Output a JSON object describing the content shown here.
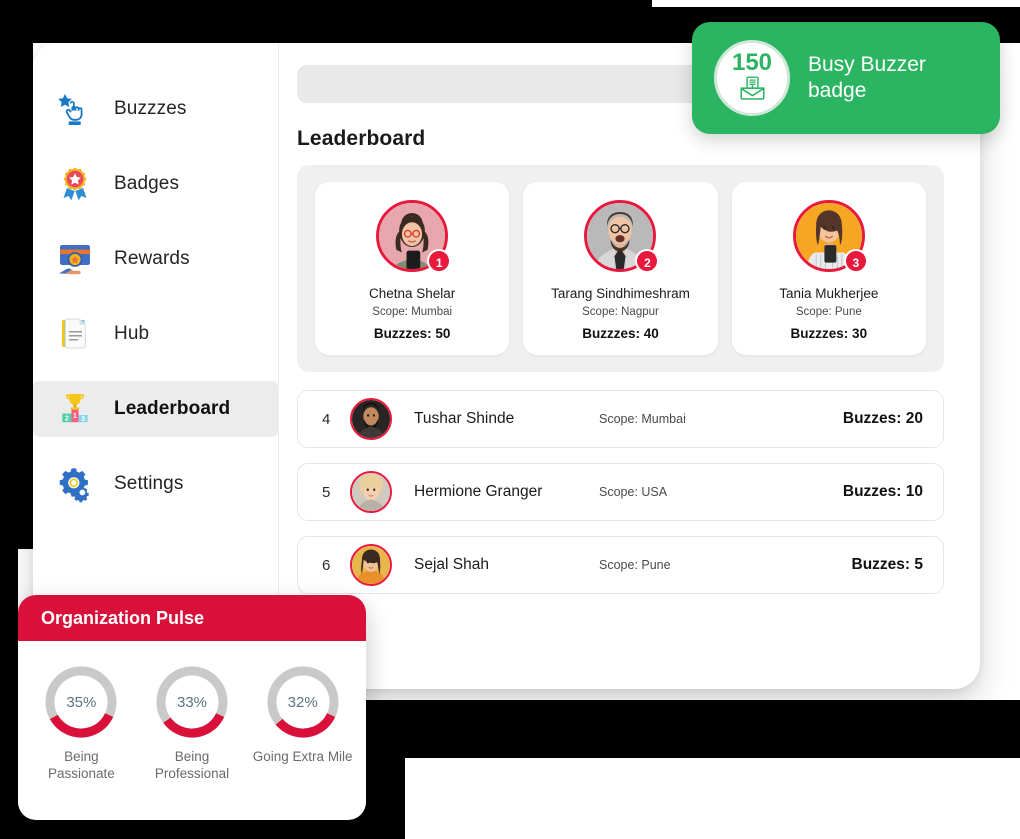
{
  "sidebar": {
    "items": [
      {
        "label": "Buzzzes",
        "icon": "hand-tap-star-icon",
        "active": false
      },
      {
        "label": "Badges",
        "icon": "rosette-star-icon",
        "active": false
      },
      {
        "label": "Rewards",
        "icon": "reward-card-hand-icon",
        "active": false
      },
      {
        "label": "Hub",
        "icon": "document-pages-icon",
        "active": false
      },
      {
        "label": "Leaderboard",
        "icon": "podium-trophy-icon",
        "active": true
      },
      {
        "label": "Settings",
        "icon": "gears-icon",
        "active": false
      }
    ]
  },
  "main": {
    "search_placeholder": "",
    "page_title": "Leaderboard"
  },
  "podium": [
    {
      "rank": "1",
      "name": "Chetna Shelar",
      "scope": "Scope: Mumbai",
      "buzzes": "Buzzzes: 50",
      "avatar_bg": "#e8a6ad"
    },
    {
      "rank": "2",
      "name": "Tarang Sindhimeshram",
      "scope": "Scope: Nagpur",
      "buzzes": "Buzzzes: 40",
      "avatar_bg": "#b9b9b9"
    },
    {
      "rank": "3",
      "name": "Tania Mukherjee",
      "scope": "Scope: Pune",
      "buzzes": "Buzzzes: 30",
      "avatar_bg": "#f5a623"
    }
  ],
  "rows": [
    {
      "num": "4",
      "name": "Tushar Shinde",
      "scope": "Scope: Mumbai",
      "buzzes": "Buzzes: 20",
      "avatar_bg": "#2a2422"
    },
    {
      "num": "5",
      "name": "Hermione Granger",
      "scope": "Scope: USA",
      "buzzes": "Buzzes: 10",
      "avatar_bg": "#cfc9c2"
    },
    {
      "num": "6",
      "name": "Sejal Shah",
      "scope": "Scope: Pune",
      "buzzes": "Buzzes: 5",
      "avatar_bg": "#e8b64c"
    }
  ],
  "badge_toast": {
    "count": "150",
    "title": "Busy Buzzer badge",
    "icon": "envelope-download-icon",
    "color": "#2bb462"
  },
  "pulse": {
    "title": "Organization Pulse",
    "accent": "#d8103a",
    "track": "#c9c9c9",
    "chart_data": {
      "type": "pie",
      "title": "Organization Pulse",
      "categories": [
        "Being Passionate",
        "Being Professional",
        "Going Extra Mile"
      ],
      "values": [
        35,
        33,
        32
      ],
      "value_labels": [
        "35%",
        "33%",
        "32%"
      ],
      "ylim": [
        0,
        100
      ],
      "legend": "none",
      "grid": false
    }
  }
}
